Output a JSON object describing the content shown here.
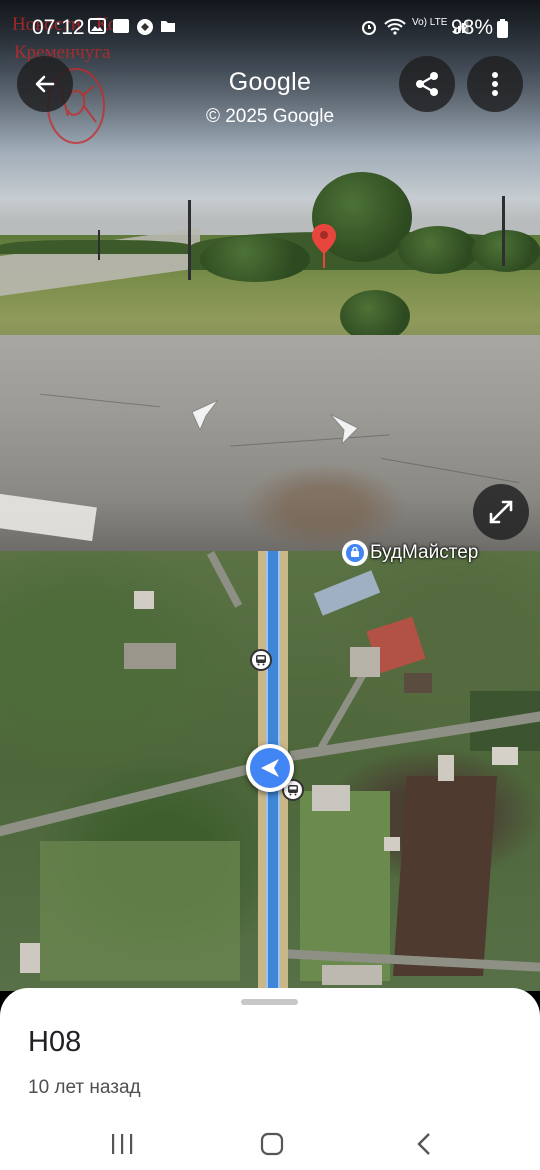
{
  "status_bar": {
    "time": "07:12",
    "battery": "98%",
    "network": "Vo) LTE",
    "icons": [
      "gallery-icon",
      "image-icon",
      "portal-icon",
      "more-notifications-dot",
      "alarm-icon",
      "wifi-icon",
      "signal-icon",
      "battery-icon"
    ]
  },
  "watermark": {
    "line1": "Новости",
    "line1_b": "Ко",
    "line2": "Кременчуга"
  },
  "streetview": {
    "title": "Google",
    "copyright": "© 2025 Google",
    "buttons": [
      "back-button",
      "share-button",
      "more-button",
      "expand-button"
    ]
  },
  "map": {
    "place_label": "БудМайстер",
    "colors": {
      "route": "#3f86d8",
      "location": "#4285f4"
    }
  },
  "sheet": {
    "title": "H08",
    "subtitle": "10 лет назад"
  }
}
